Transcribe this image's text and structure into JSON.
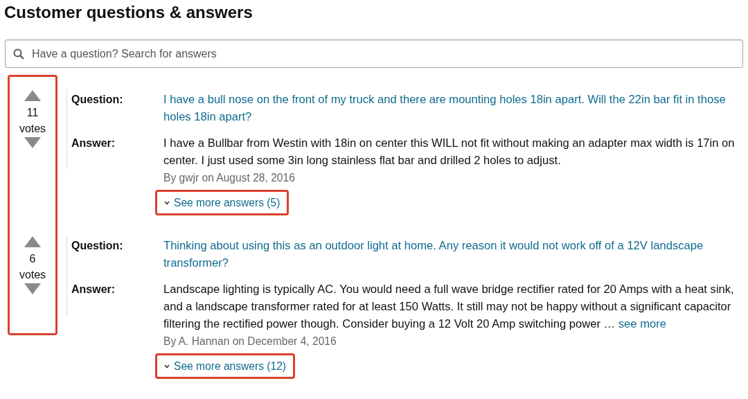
{
  "title": "Customer questions & answers",
  "search": {
    "placeholder": "Have a question? Search for answers"
  },
  "votes_annotated": true,
  "questions": [
    {
      "votes": "11",
      "votes_label": "votes",
      "question_label": "Question:",
      "question": "I have a bull nose on the front of my truck and there are mounting holes 18in apart. Will the 22in bar fit in those holes 18in apart?",
      "answer_label": "Answer:",
      "answer": "I have a Bullbar from Westin with 18in on center this WILL not fit without making an adapter max width is 17in on center. I just used some 3in long stainless flat bar and drilled 2 holes to adjust.",
      "byline": "By gwjr on August 28, 2016",
      "more_answers": "See more answers (5)",
      "more_annotated": true
    },
    {
      "votes": "6",
      "votes_label": "votes",
      "question_label": "Question:",
      "question": "Thinking about using this as an outdoor light at home. Any reason it would not work off of a 12V landscape transformer?",
      "answer_label": "Answer:",
      "answer": "Landscape lighting is typically AC. You would need a full wave bridge rectifier rated for 20 Amps with a heat sink, and a landscape transformer rated for at least 150 Watts. It still may not be happy without a significant capacitor filtering the rectified power though. Consider buying a 12 Volt 20 Amp switching power …",
      "see_more": "see more",
      "byline": "By A. Hannan on December 4, 2016",
      "more_answers": "See more answers (12)",
      "more_annotated": true
    }
  ]
}
